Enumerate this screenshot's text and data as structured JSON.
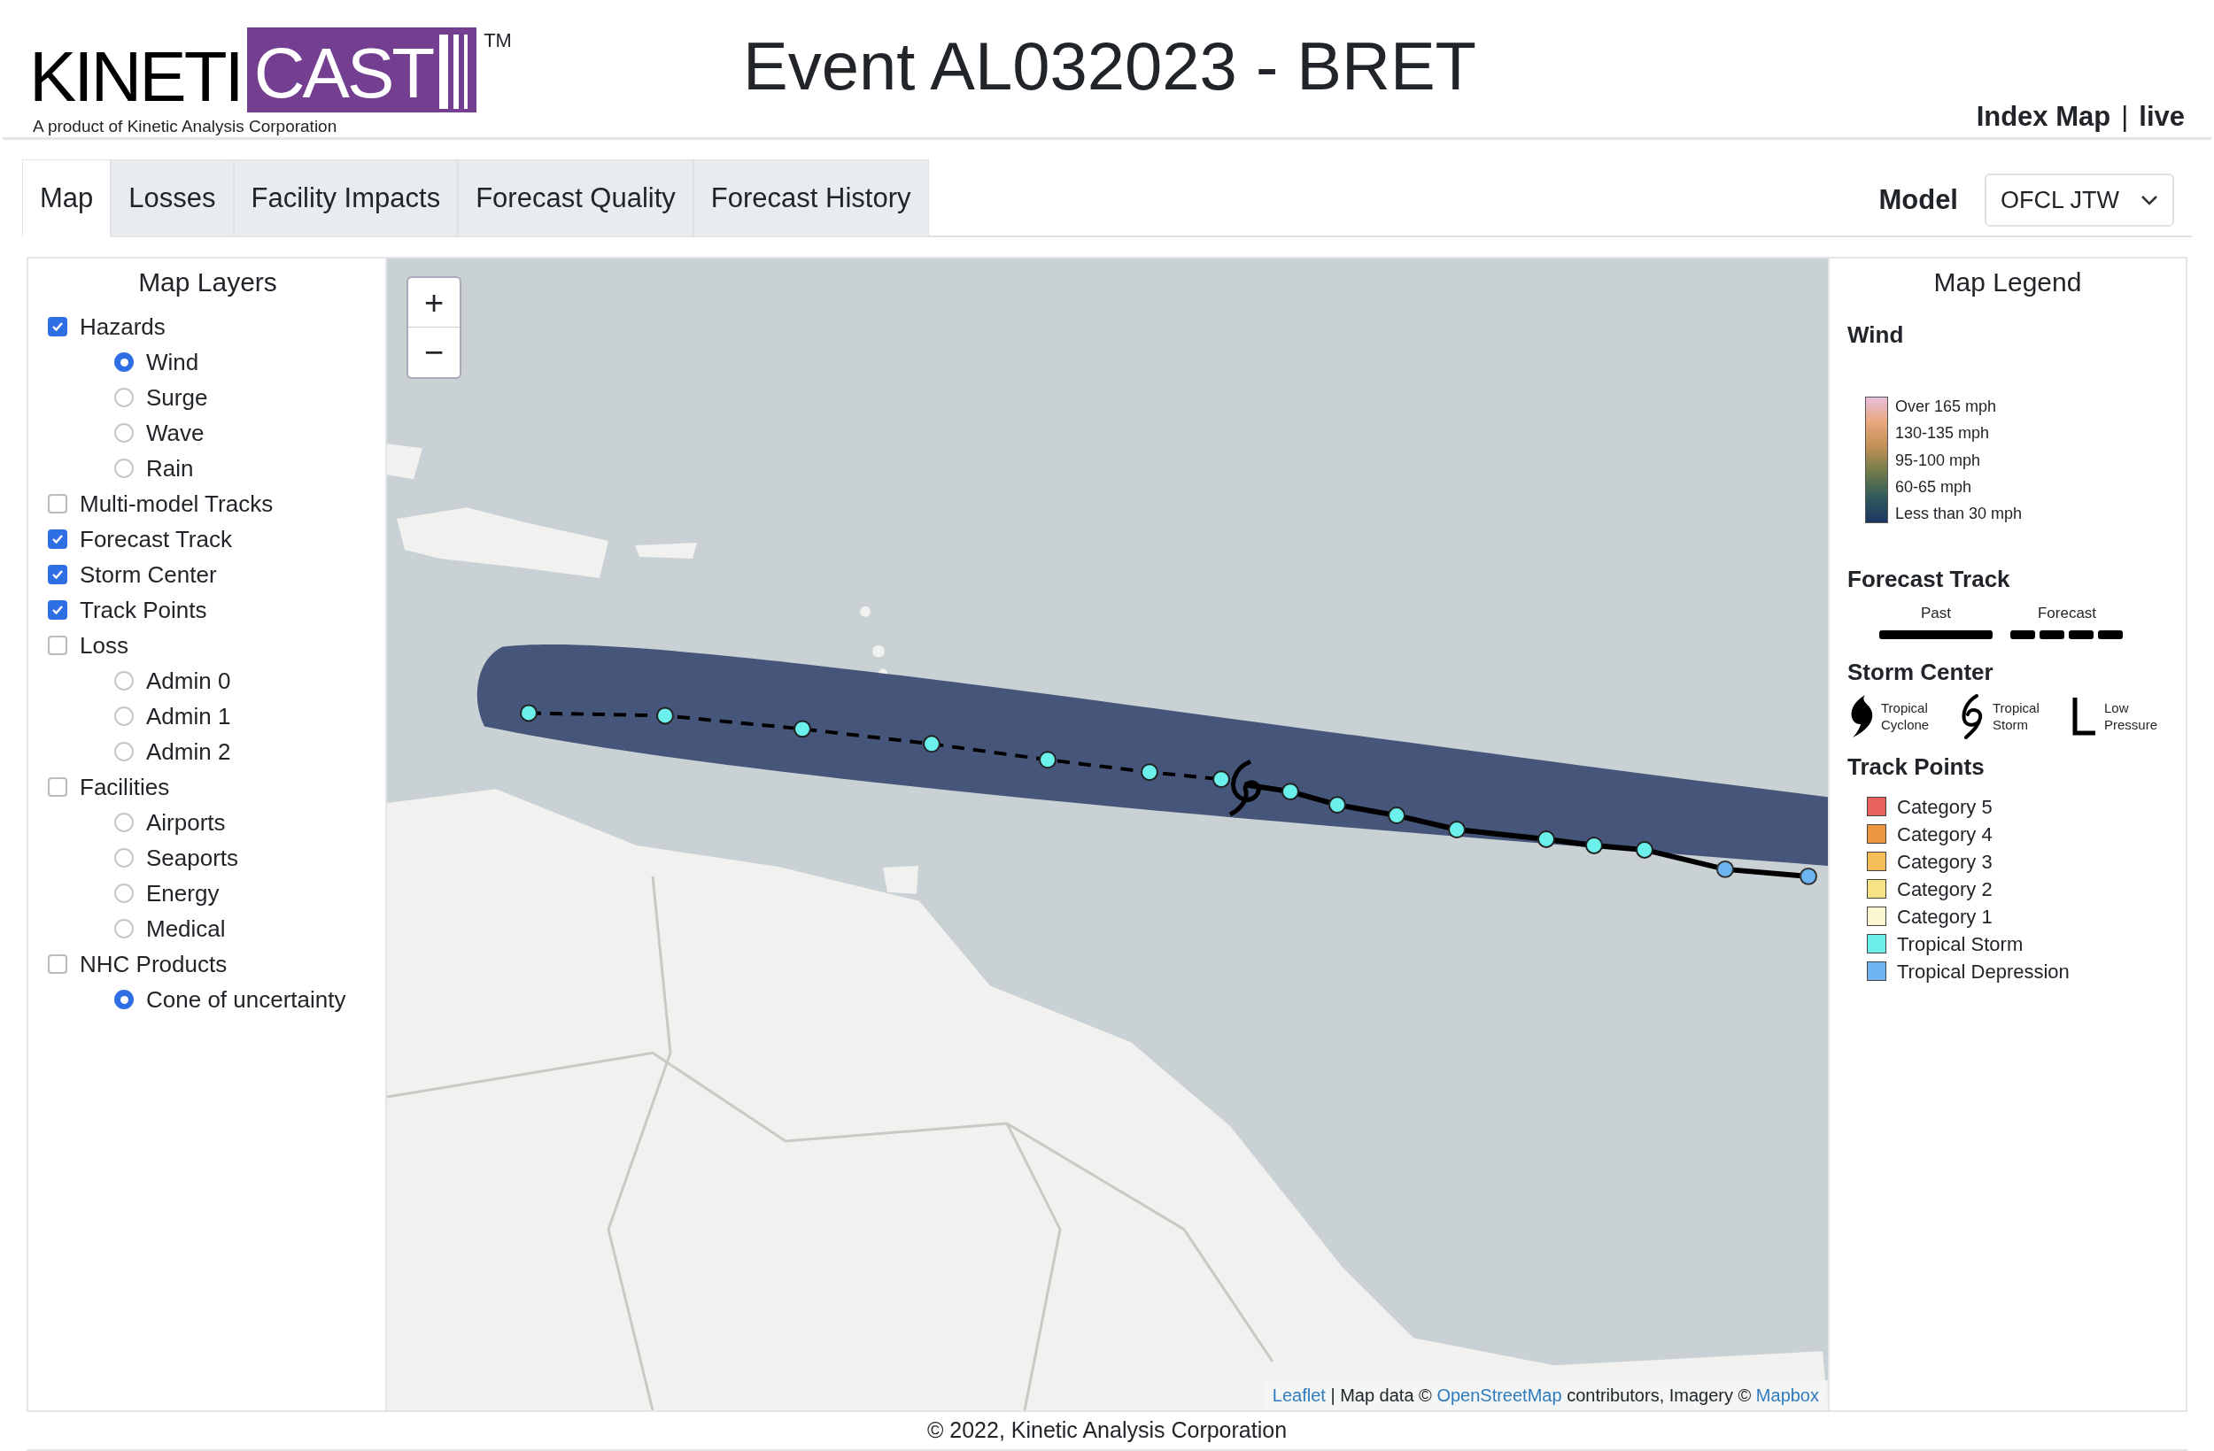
{
  "logo": {
    "left": "KINETI",
    "right": "CAST",
    "trademark": "TM",
    "tagline": "A product of Kinetic Analysis Corporation"
  },
  "title": "Event AL032023 - BRET",
  "header_links": [
    {
      "label": "Index Map"
    },
    {
      "label": "|"
    },
    {
      "label": "live"
    }
  ],
  "tabs": [
    {
      "label": "Map",
      "selected": true
    },
    {
      "label": "Losses",
      "selected": false
    },
    {
      "label": "Facility Impacts",
      "selected": false
    },
    {
      "label": "Forecast Quality",
      "selected": false
    },
    {
      "label": "Forecast History",
      "selected": false
    }
  ],
  "model": {
    "label": "Model",
    "value": "OFCL JTW"
  },
  "layers": {
    "title": "Map Layers",
    "items": [
      {
        "label": "Hazards",
        "checked": true,
        "children": [
          {
            "label": "Wind",
            "selected": true
          },
          {
            "label": "Surge",
            "selected": false
          },
          {
            "label": "Wave",
            "selected": false
          },
          {
            "label": "Rain",
            "selected": false
          }
        ]
      },
      {
        "label": "Multi-model Tracks",
        "checked": false
      },
      {
        "label": "Forecast Track",
        "checked": true
      },
      {
        "label": "Storm Center",
        "checked": true
      },
      {
        "label": "Track Points",
        "checked": true
      },
      {
        "label": "Loss",
        "checked": false,
        "children": [
          {
            "label": "Admin 0",
            "selected": false
          },
          {
            "label": "Admin 1",
            "selected": false
          },
          {
            "label": "Admin 2",
            "selected": false
          }
        ]
      },
      {
        "label": "Facilities",
        "checked": false,
        "children": [
          {
            "label": "Airports",
            "selected": false
          },
          {
            "label": "Seaports",
            "selected": false
          },
          {
            "label": "Energy",
            "selected": false
          },
          {
            "label": "Medical",
            "selected": false
          }
        ]
      },
      {
        "label": "NHC Products",
        "checked": false,
        "children": [
          {
            "label": "Cone of uncertainty",
            "selected": true
          }
        ]
      }
    ]
  },
  "map": {
    "zoom_in": "+",
    "zoom_out": "−",
    "attribution": [
      {
        "text": "Leaflet",
        "kind": "link"
      },
      {
        "text": " | Map data © ",
        "kind": "text"
      },
      {
        "text": "OpenStreetMap",
        "kind": "link"
      },
      {
        "text": " contributors, Imagery © ",
        "kind": "text"
      },
      {
        "text": "Mapbox",
        "kind": "link"
      }
    ]
  },
  "legend": {
    "title": "Map Legend",
    "wind": {
      "title": "Wind",
      "labels": [
        "Over 165 mph",
        "130-135 mph",
        "95-100 mph",
        "60-65 mph",
        "Less than 30 mph"
      ]
    },
    "forecast_track": {
      "title": "Forecast Track",
      "items": [
        {
          "label": "Past",
          "kind": "solid"
        },
        {
          "label": "Forecast",
          "kind": "dashed"
        }
      ]
    },
    "storm_center": {
      "title": "Storm Center",
      "items": [
        {
          "label": "Tropical Cyclone",
          "kind": "cyclone"
        },
        {
          "label": "Tropical Storm",
          "kind": "storm"
        },
        {
          "label": "Low Pressure",
          "kind": "low"
        }
      ]
    },
    "track_points": {
      "title": "Track Points",
      "items": [
        {
          "label": "Category 5",
          "color": "#e8625c"
        },
        {
          "label": "Category 4",
          "color": "#ee9640"
        },
        {
          "label": "Category 3",
          "color": "#f4bd58"
        },
        {
          "label": "Category 2",
          "color": "#f8e384"
        },
        {
          "label": "Category 1",
          "color": "#fdf7cf"
        },
        {
          "label": "Tropical Storm",
          "color": "#6cf0ec"
        },
        {
          "label": "Tropical Depression",
          "color": "#6db4f0"
        }
      ]
    }
  },
  "footer": "© 2022, Kinetic Analysis Corporation"
}
